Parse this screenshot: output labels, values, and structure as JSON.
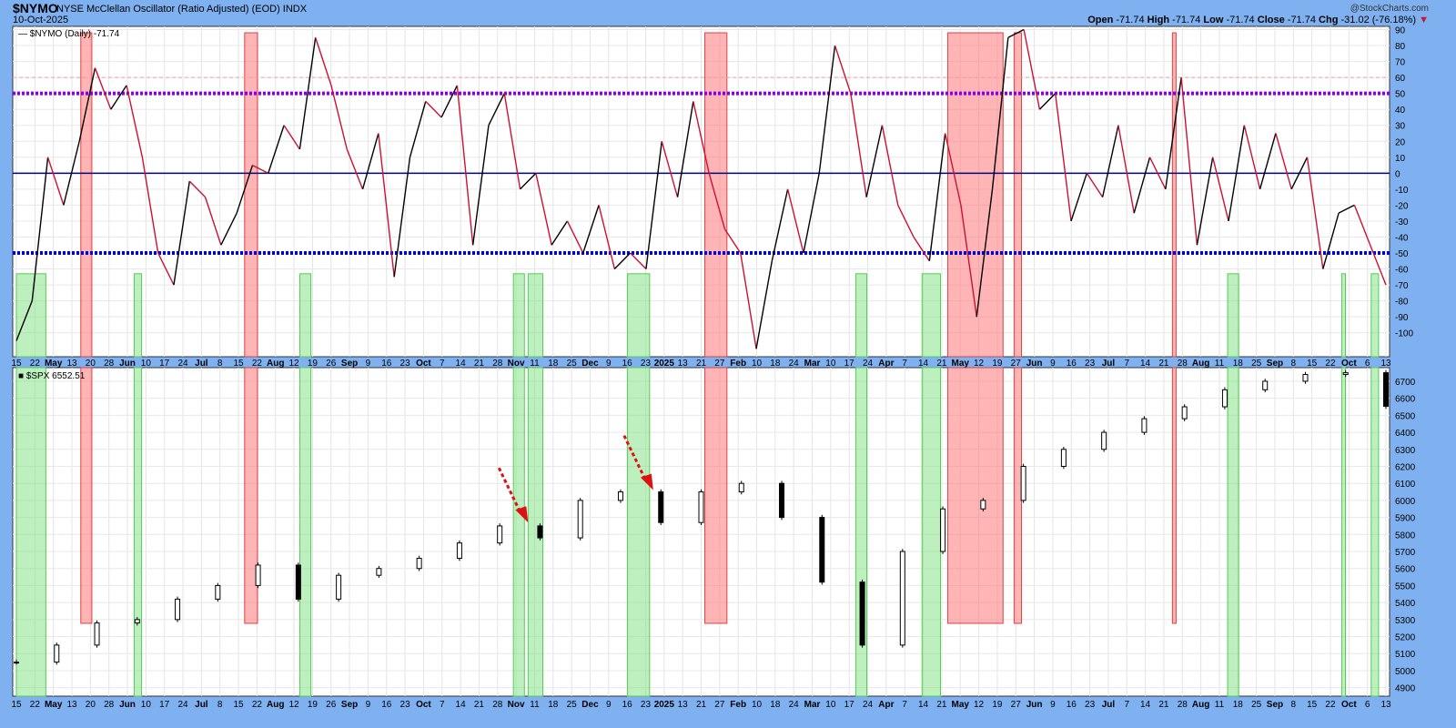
{
  "header": {
    "symbol": "$NYMO",
    "description": "NYSE McClellan Oscillator (Ratio Adjusted) (EOD) INDX",
    "date": "10-Oct-2025",
    "watermark": "@StockCharts.com",
    "open_label": "Open",
    "open": "-71.74",
    "high_label": "High",
    "high": "-71.74",
    "low_label": "Low",
    "low": "-71.74",
    "close_label": "Close",
    "close": "-71.74",
    "chg_label": "Chg",
    "chg": "-31.02 (-76.18%)"
  },
  "colors": {
    "background": "#7fb0f0",
    "panel": "#ffffff",
    "up": "#000000",
    "down": "#cc1133",
    "purple": "#8800ee",
    "blue": "#0000dd",
    "zero": "#000080",
    "red_zone": "#ff6b6b",
    "green_zone": "#7ee07e"
  },
  "chart_data": [
    {
      "type": "line",
      "legend": "$NYMO (Daily) -71.74",
      "ylim": [
        -115,
        92
      ],
      "yticks": [
        90,
        80,
        70,
        60,
        50,
        40,
        30,
        20,
        10,
        0,
        -10,
        -20,
        -30,
        -40,
        -50,
        -60,
        -70,
        -80,
        -90,
        -100
      ],
      "reference_lines": [
        {
          "y": 60,
          "style": "dashed",
          "color": "#f0a0a0"
        },
        {
          "y": 50,
          "style": "dotted",
          "color": "#8800ee"
        },
        {
          "y": 0,
          "style": "solid",
          "color": "#000080"
        },
        {
          "y": -50,
          "style": "dotted",
          "color": "#0000dd"
        }
      ],
      "x": [
        0,
        5,
        10,
        15,
        20,
        25,
        30,
        35,
        40,
        45,
        50,
        55,
        60,
        65,
        70,
        75,
        80,
        85,
        90,
        95,
        100,
        105,
        110,
        115,
        120,
        125,
        130,
        135,
        140,
        145,
        150,
        155,
        160,
        165,
        170,
        175,
        180,
        185,
        190,
        195,
        200,
        205,
        210,
        215,
        220,
        225,
        230,
        235,
        240,
        245,
        250,
        255,
        260,
        265,
        270,
        275,
        280,
        285,
        290,
        295,
        300,
        305,
        310,
        315,
        320,
        325,
        330,
        335,
        340,
        345,
        350,
        355
      ],
      "values": [
        -105,
        -80,
        10,
        -20,
        20,
        66,
        40,
        55,
        10,
        -50,
        -70,
        -5,
        -15,
        -45,
        -25,
        5,
        0,
        30,
        15,
        85,
        55,
        15,
        -10,
        25,
        -65,
        10,
        45,
        35,
        55,
        -45,
        30,
        50,
        -10,
        0,
        -45,
        -30,
        -50,
        -20,
        -60,
        -50,
        -60,
        20,
        -15,
        45,
        0,
        -35,
        -50,
        -110,
        -55,
        -10,
        -50,
        0,
        80,
        50,
        -15,
        30,
        -20,
        -40,
        -55,
        25,
        -20,
        -90,
        -10,
        85,
        90,
        40,
        50,
        -30,
        0,
        -15,
        30,
        -25,
        10,
        -10,
        60,
        -45,
        10,
        -30,
        30,
        -10,
        25,
        -10,
        10,
        -60,
        -25,
        -20,
        -45,
        -70
      ],
      "color_rule": "black when rising, red when falling"
    },
    {
      "type": "candlestick",
      "legend": "$SPX 6552.51",
      "ylim": [
        4850,
        6780
      ],
      "yticks": [
        6700,
        6600,
        6500,
        6400,
        6300,
        6200,
        6100,
        6000,
        5900,
        5800,
        5700,
        5600,
        5500,
        5400,
        5300,
        5200,
        5100,
        5000,
        4900
      ],
      "x": [
        0,
        10,
        20,
        30,
        40,
        50,
        60,
        70,
        80,
        90,
        100,
        110,
        120,
        130,
        140,
        150,
        160,
        170,
        180,
        190,
        200,
        210,
        220,
        230,
        240,
        250,
        260,
        270,
        280,
        290,
        300,
        310,
        320,
        330,
        340,
        350,
        355
      ],
      "close": [
        5050,
        5150,
        5280,
        5300,
        5420,
        5500,
        5620,
        5420,
        5560,
        5600,
        5660,
        5750,
        5850,
        5780,
        6000,
        6050,
        5870,
        6050,
        6100,
        5900,
        5520,
        5150,
        5700,
        5950,
        6000,
        6200,
        6300,
        6400,
        6480,
        6550,
        6650,
        6700,
        6740,
        6750,
        6553
      ],
      "x_labels": [
        "15",
        "22",
        "May",
        "13",
        "20",
        "28",
        "Jun",
        "10",
        "17",
        "24",
        "Jul",
        "8",
        "15",
        "22",
        "Aug",
        "12",
        "19",
        "26",
        "Sep",
        "9",
        "16",
        "23",
        "Oct",
        "7",
        "14",
        "21",
        "28",
        "Nov",
        "11",
        "18",
        "25",
        "Dec",
        "9",
        "16",
        "23",
        "2025",
        "13",
        "21",
        "27",
        "Feb",
        "10",
        "18",
        "24",
        "Mar",
        "10",
        "17",
        "24",
        "Apr",
        "7",
        "14",
        "21",
        "May",
        "12",
        "19",
        "27",
        "Jun",
        "9",
        "16",
        "23",
        "Jul",
        "7",
        "14",
        "21",
        "28",
        "Aug",
        "11",
        "18",
        "25",
        "Sep",
        "8",
        "15",
        "22",
        "Oct",
        "6",
        "13"
      ]
    }
  ],
  "zones": {
    "red": [
      [
        17.5,
        20.5
      ],
      [
        62,
        65.5
      ],
      [
        187,
        193
      ],
      [
        253,
        268
      ],
      [
        271,
        273
      ],
      [
        314,
        315
      ]
    ],
    "green": [
      [
        0,
        8
      ],
      [
        32,
        34
      ],
      [
        77,
        80
      ],
      [
        135,
        138
      ],
      [
        139,
        143
      ],
      [
        166,
        172
      ],
      [
        228,
        231
      ],
      [
        246,
        251
      ],
      [
        329,
        332
      ],
      [
        360,
        361
      ],
      [
        368,
        370
      ]
    ]
  },
  "annotations": {
    "arrows": [
      {
        "at": 138,
        "price": 5870
      },
      {
        "at": 172,
        "price": 6060
      }
    ]
  }
}
